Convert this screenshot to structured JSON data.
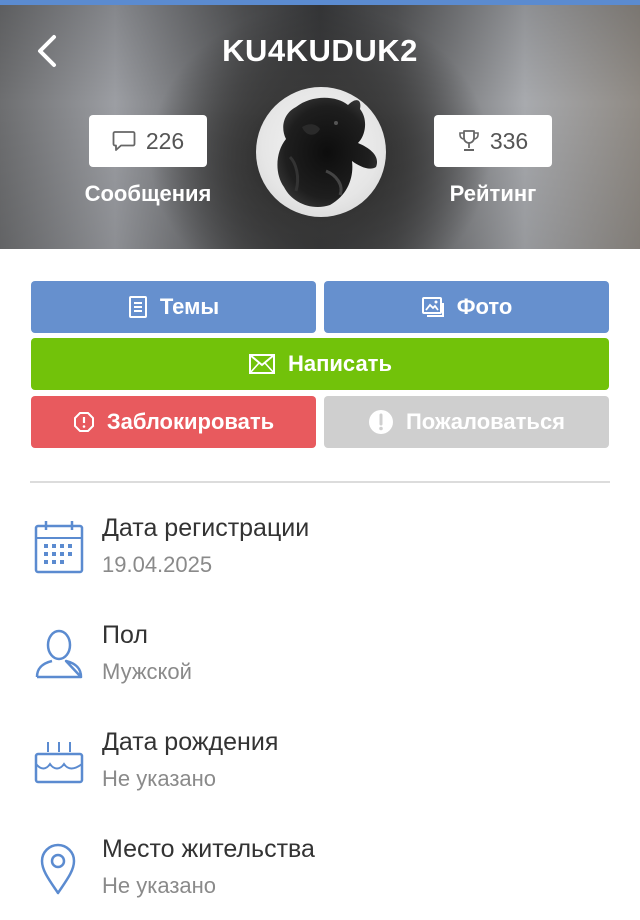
{
  "header": {
    "title": "KU4KUDUK2",
    "messages": {
      "count": "226",
      "label": "Сообщения",
      "icon": "speech-bubble-icon"
    },
    "rating": {
      "count": "336",
      "label": "Рейтинг",
      "icon": "trophy-icon"
    },
    "back_icon": "chevron-left-icon"
  },
  "actions": {
    "topics": {
      "label": "Темы",
      "icon": "document-icon",
      "color": "#6690ce"
    },
    "photo": {
      "label": "Фото",
      "icon": "photo-album-icon",
      "color": "#6690ce"
    },
    "write": {
      "label": "Написать",
      "icon": "envelope-icon",
      "color": "#72c20a"
    },
    "block": {
      "label": "Заблокировать",
      "icon": "stop-octagon-icon",
      "color": "#e85a5e"
    },
    "report": {
      "label": "Пожаловаться",
      "icon": "exclamation-circle-icon",
      "color": "#cfcfcf"
    }
  },
  "info": [
    {
      "label": "Дата регистрации",
      "value": "19.04.2025",
      "icon": "calendar-icon"
    },
    {
      "label": "Пол",
      "value": "Мужской",
      "icon": "person-icon"
    },
    {
      "label": "Дата рождения",
      "value": "Не указано",
      "icon": "birthday-cake-icon"
    },
    {
      "label": "Место жительства",
      "value": "Не указано",
      "icon": "location-pin-icon"
    }
  ],
  "colors": {
    "accent_line": "#5b8bd0",
    "icon_blue": "#5b8bd0"
  }
}
